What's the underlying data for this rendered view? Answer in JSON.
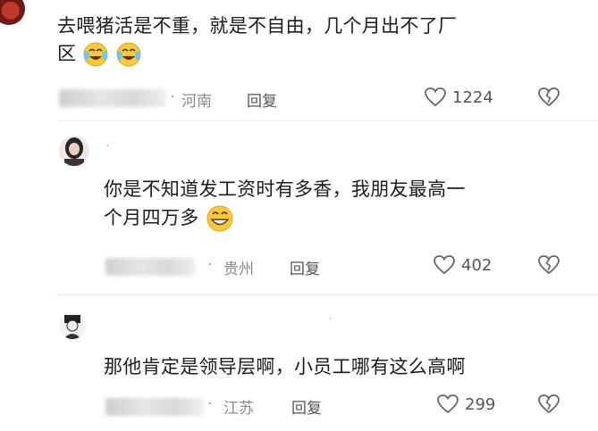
{
  "comments": [
    {
      "text_line1": "去喂猪活是不重，就是不自由，几个月出不了厂",
      "text_line2": "区",
      "location": "河南",
      "reply_label": "回复",
      "like_count": "1224"
    },
    {
      "text_line1": "你是不知道发工资时有多香，我朋友最高一",
      "text_line2": "个月四万多",
      "location": "贵州",
      "reply_label": "回复",
      "like_count": "402"
    },
    {
      "text_line1": "那他肯定是领导层啊，小员工哪有这么高啊",
      "location": "江苏",
      "reply_label": "回复",
      "like_count": "299"
    }
  ],
  "icons": {
    "like": "heart-outline-icon",
    "dislike": "broken-heart-icon",
    "emoji_crying": "laughing-crying-emoji-icon",
    "emoji_grin": "grinning-emoji-icon"
  }
}
